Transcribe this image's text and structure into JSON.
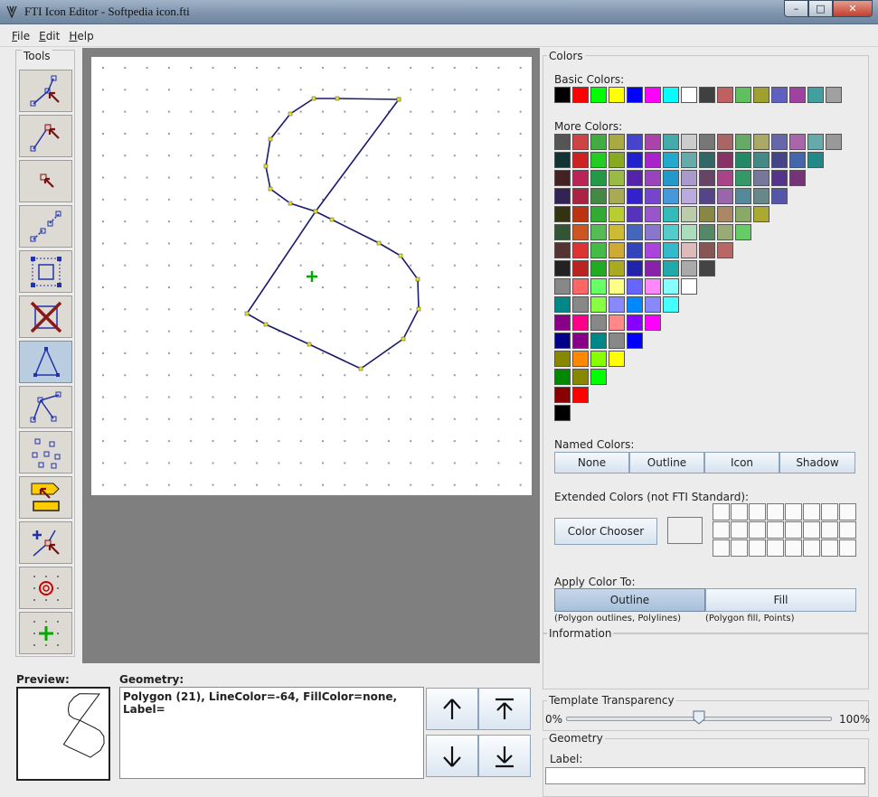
{
  "window": {
    "title": "FTI Icon Editor - Softpedia icon.fti",
    "min": "–",
    "max": "□",
    "close": "✕"
  },
  "menu": [
    {
      "label": "File",
      "key": "F",
      "rest": "ile"
    },
    {
      "label": "Edit",
      "key": "E",
      "rest": "dit"
    },
    {
      "label": "Help",
      "key": "H",
      "rest": "elp"
    }
  ],
  "tools": {
    "label": "Tools",
    "items": [
      "move-vertex-icon",
      "drag-line-icon",
      "select-point-icon",
      "dotted-line-icon",
      "bounding-box-icon",
      "delete-icon",
      "polygon-icon",
      "polyline-icon",
      "points-icon",
      "label-icon",
      "add-vertex-icon",
      "target-center-icon",
      "green-center-icon"
    ],
    "active_index": 6
  },
  "colors": {
    "section_title": "Colors",
    "basic_label": "Basic Colors:",
    "basic": [
      "#000000",
      "#ff0000",
      "#00ff00",
      "#ffff00",
      "#0000ff",
      "#ff00ff",
      "#00ffff",
      "#ffffff",
      "#404040",
      "#c06060",
      "#60c060",
      "#a0a030",
      "#6060c0",
      "#a040a0",
      "#40a0a0",
      "#a0a0a0"
    ],
    "more_label": "More Colors:",
    "more_rows": [
      [
        "#555555",
        "#cc4444",
        "#44aa44",
        "#aaaa44",
        "#4444cc",
        "#aa44aa",
        "#44aaaa",
        "#cccccc",
        "#777777",
        "#aa6666",
        "#66aa66",
        "#aaaa66",
        "#6666aa",
        "#aa66aa",
        "#66aaaa",
        "#999999"
      ],
      [
        "#113333",
        "#cc2222",
        "#22cc22",
        "#88aa22",
        "#2222cc",
        "#aa22cc",
        "#22aacc",
        "#66aaaa",
        "#336666",
        "#883366",
        "#228866",
        "#448888",
        "#444488",
        "#4466aa",
        "#228888"
      ],
      [
        "#442222",
        "#bb2255",
        "#229944",
        "#99bb44",
        "#5522aa",
        "#9944bb",
        "#2299cc",
        "#aa99cc",
        "#664466",
        "#aa4488",
        "#339966",
        "#777799",
        "#553388",
        "#773377"
      ],
      [
        "#332255",
        "#aa2244",
        "#448844",
        "#aaaa55",
        "#3322cc",
        "#7744cc",
        "#4499dd",
        "#bbaadd",
        "#554488",
        "#9966aa",
        "#558899",
        "#668888",
        "#5555aa"
      ],
      [
        "#333311",
        "#bb3311",
        "#33aa33",
        "#bbcc33",
        "#5533bb",
        "#9955cc",
        "#33bbbb",
        "#bbccaa",
        "#888844",
        "#aa8866",
        "#88aa66",
        "#aaaa33"
      ],
      [
        "#335533",
        "#cc5522",
        "#55bb55",
        "#ccbb33",
        "#4466bb",
        "#8877cc",
        "#55cccc",
        "#aaddbb",
        "#558866",
        "#99aa77",
        "#66cc66"
      ],
      [
        "#553333",
        "#dd3333",
        "#44bb44",
        "#ccaa33",
        "#3344bb",
        "#aa44dd",
        "#33bbcc",
        "#ddbbbb",
        "#885555",
        "#bb6666"
      ],
      [
        "#222222",
        "#bb2222",
        "#22aa22",
        "#aaaa22",
        "#2222aa",
        "#8822aa",
        "#22aaaa",
        "#aaaaaa",
        "#444444"
      ],
      [
        "#888888",
        "#ff6666",
        "#66ff66",
        "#ffff88",
        "#6666ff",
        "#ff88ff",
        "#88ffff",
        "#ffffff"
      ],
      [
        "#008888",
        "#888888",
        "#88ff44",
        "#8888ff",
        "#0088ff",
        "#8888ff",
        "#44ffff"
      ],
      [
        "#880088",
        "#ff0088",
        "#888888",
        "#ff8888",
        "#8800ff",
        "#ff00ff"
      ],
      [
        "#000088",
        "#880088",
        "#008888",
        "#888888",
        "#0000ff"
      ],
      [
        "#888800",
        "#ff8800",
        "#88ff00",
        "#ffff00"
      ],
      [
        "#008800",
        "#888800",
        "#00ff00"
      ],
      [
        "#880000",
        "#ff0000"
      ],
      [
        "#000000"
      ]
    ],
    "named_label": "Named Colors:",
    "named_buttons": [
      "None",
      "Outline",
      "Icon",
      "Shadow"
    ],
    "extended_label": "Extended Colors (not FTI Standard):",
    "chooser_label": "Color Chooser",
    "apply_label": "Apply Color To:",
    "apply_outline": "Outline",
    "apply_fill": "Fill",
    "apply_outline_hint": "(Polygon outlines, Polylines)",
    "apply_fill_hint": "(Polygon fill, Points)"
  },
  "information": {
    "title": "Information"
  },
  "transparency": {
    "title": "Template Transparency",
    "min": "0%",
    "max": "100%",
    "value": 0.5
  },
  "geometry_panel": {
    "title": "Geometry",
    "label_caption": "Label:",
    "label_value": ""
  },
  "preview": {
    "label": "Preview:"
  },
  "geometry": {
    "label": "Geometry:",
    "text": "Polygon (21), LineColor=-64, FillColor=none, Label="
  },
  "accent": "#1a1a6e"
}
